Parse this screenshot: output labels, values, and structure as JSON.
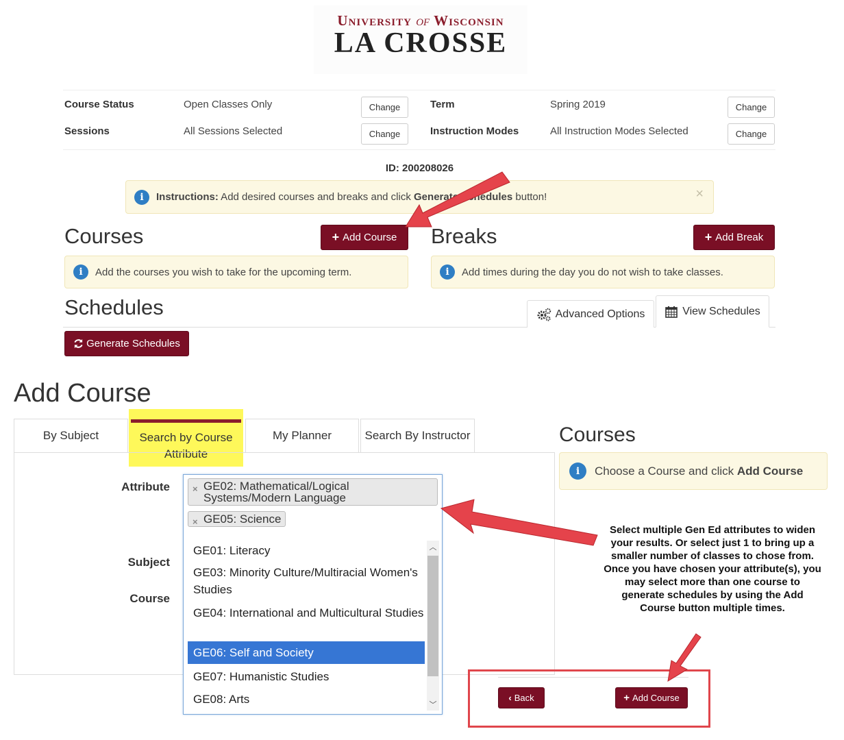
{
  "logo": {
    "line1_a": "University",
    "line1_of": "of",
    "line1_b": "Wisconsin",
    "line2": "LA CROSSE"
  },
  "settings": {
    "course_status_label": "Course Status",
    "course_status_value": "Open Classes Only",
    "sessions_label": "Sessions",
    "sessions_value": "All Sessions Selected",
    "term_label": "Term",
    "term_value": "Spring 2019",
    "modes_label": "Instruction Modes",
    "modes_value": "All Instruction Modes Selected",
    "change_label": "Change"
  },
  "id_line": "ID: 200208026",
  "instructions": {
    "bold": "Instructions:",
    "pre": " Add desired courses and breaks and click ",
    "bold2": "Generate Schedules",
    "post": " button!"
  },
  "courses": {
    "title": "Courses",
    "add_btn": "Add Course",
    "info": "Add the courses you wish to take for the upcoming term."
  },
  "breaks": {
    "title": "Breaks",
    "add_btn": "Add Break",
    "info": "Add times during the day you do not wish to take classes."
  },
  "schedules": {
    "title": "Schedules",
    "tab_advanced": "Advanced Options",
    "tab_view": "View Schedules",
    "generate_btn": "Generate Schedules"
  },
  "add_course": {
    "title": "Add Course",
    "tabs": [
      "By Subject",
      "Search by Course Attribute",
      "My Planner",
      "Search By Instructor"
    ],
    "labels": {
      "attribute": "Attribute",
      "subject": "Subject",
      "course": "Course"
    },
    "chips": [
      "GE02: Mathematical/Logical Systems/Modern Language",
      "GE05: Science"
    ],
    "options": [
      "GE01: Literacy",
      "GE03: Minority Culture/Multiracial Women's Studies",
      "GE04: International and Multicultural Studies",
      "GE06: Self and Society",
      "GE07: Humanistic Studies",
      "GE08: Arts"
    ],
    "selected_option": "GE06: Self and Society",
    "right_title": "Courses",
    "right_info_pre": "Choose a Course and click ",
    "right_info_bold": "Add Course",
    "back_btn": "Back",
    "add_btn": "Add Course"
  },
  "note": "Select multiple Gen Ed attributes to widen your results. Or select just 1 to bring up a smaller number of classes to chose from. Once you have chosen your attribute(s), you may select more than one course to generate schedules by using the Add Course button multiple times.",
  "colors": {
    "maroon": "#7a0f25",
    "highlight": "#fef85a",
    "arrow": "#e5434b",
    "selected": "#3676d4"
  }
}
